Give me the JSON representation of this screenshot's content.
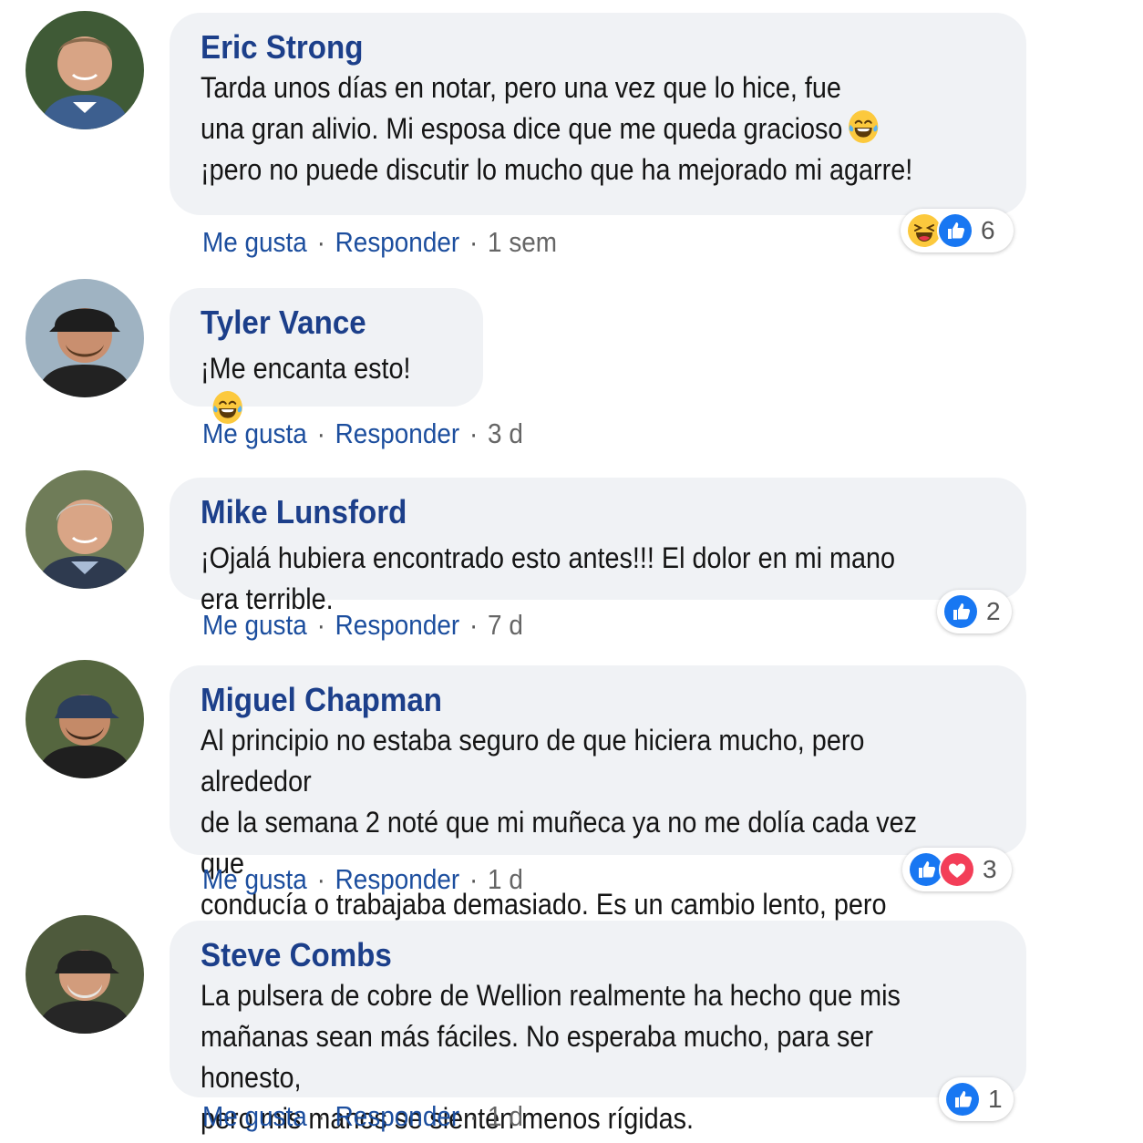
{
  "actions": {
    "like_label": "Me gusta",
    "reply_label": "Responder",
    "separator": "·"
  },
  "colors": {
    "name": "#1c3f8a",
    "link": "#1c4e9e",
    "bubble": "#f0f2f5",
    "like_blue": "#1877f2",
    "love_red": "#f33e58"
  },
  "comments": [
    {
      "author": "Eric Strong",
      "text": "Tarda unos días en notar, pero una vez que lo hice, fue\nuna gran alivio. Mi esposa dice que me queda gracioso",
      "text_after_emoji": "¡pero no puede discutir lo mucho que ha mejorado mi agarre!",
      "inline_emoji": "laughing-tears-emoji",
      "time": "1 sem",
      "reactions": {
        "icons": [
          "haha-icon",
          "like-icon"
        ],
        "count": "6"
      }
    },
    {
      "author": "Tyler Vance",
      "text": "¡Me encanta esto!",
      "inline_emoji": "laughing-tears-emoji",
      "time": "3 d"
    },
    {
      "author": "Mike Lunsford",
      "text": "¡Ojalá hubiera encontrado esto antes!!! El dolor en mi mano era terrible.",
      "time": "7 d",
      "reactions": {
        "icons": [
          "like-icon"
        ],
        "count": "2"
      }
    },
    {
      "author": "Miguel Chapman",
      "text": "Al principio no estaba seguro de que hiciera mucho, pero alrededor\nde la semana 2 noté que mi muñeca ya no me dolía cada vez que\nconducía o trabajaba demasiado. Es un cambio lento, pero funciona.",
      "time": "1 d",
      "reactions": {
        "icons": [
          "like-icon",
          "love-icon"
        ],
        "count": "3"
      }
    },
    {
      "author": "Steve Combs",
      "text": "La pulsera de cobre de Wellion realmente ha hecho que mis\nmañanas sean más fáciles. No esperaba mucho, para ser honesto,\npero mis manos se sienten menos rígidas.",
      "time": "1 d",
      "reactions": {
        "icons": [
          "like-icon"
        ],
        "count": "1"
      }
    }
  ]
}
